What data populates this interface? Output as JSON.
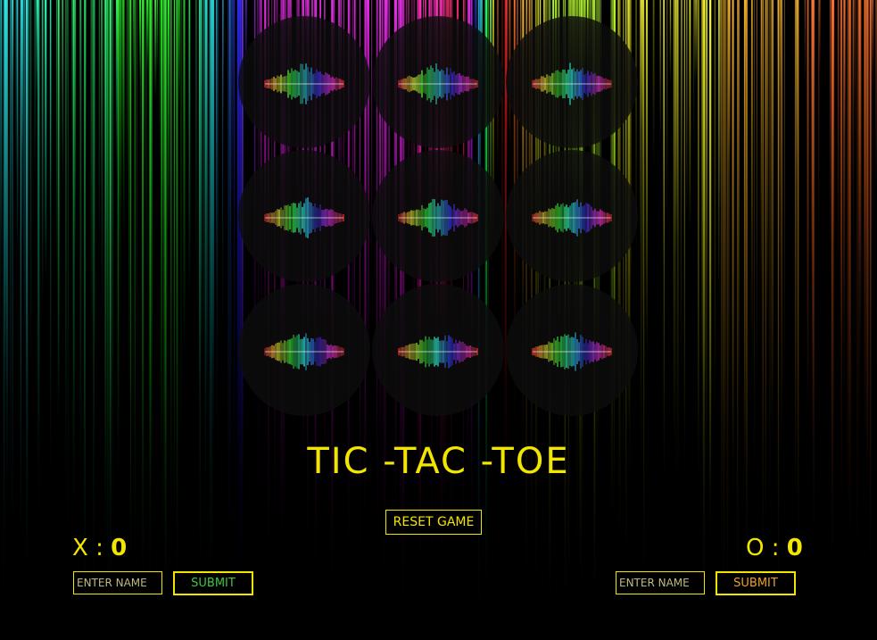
{
  "game": {
    "title": "TIC -TAC -TOE",
    "reset_label": "RESET GAME",
    "cells": [
      "",
      "",
      "",
      "",
      "",
      "",
      "",
      "",
      ""
    ]
  },
  "players": {
    "x": {
      "symbol": "X",
      "separator": ":",
      "score": "0",
      "name_placeholder": "ENTER NAME",
      "submit_label": "SUBMIT",
      "submit_color": "#3ec93e"
    },
    "o": {
      "symbol": "O",
      "separator": ":",
      "score": "0",
      "name_placeholder": "ENTER NAME",
      "submit_label": "SUBMIT",
      "submit_color": "#f0a020"
    }
  },
  "colors": {
    "accent": "#f2e600",
    "background": "#000000"
  }
}
